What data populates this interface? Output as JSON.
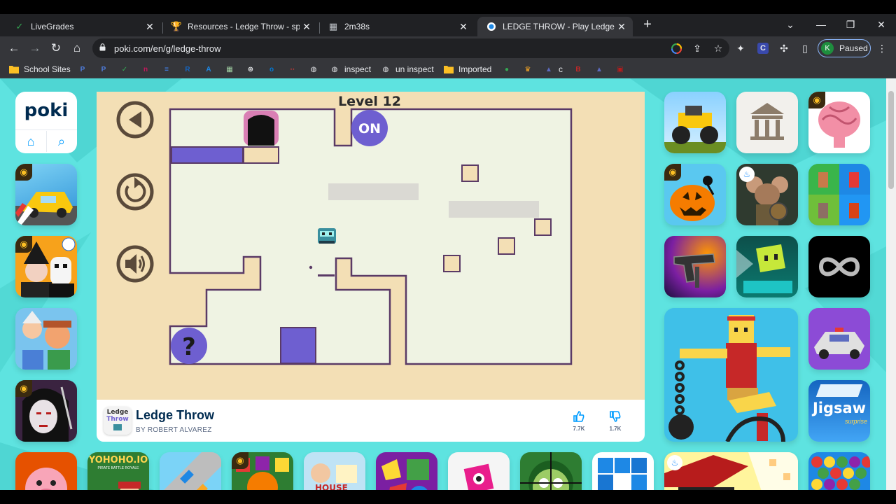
{
  "browser": {
    "tabs": [
      {
        "title": "LiveGrades",
        "icon": "check-icon",
        "active": false
      },
      {
        "title": "Resources - Ledge Throw - speed",
        "icon": "trophy-icon",
        "active": false
      },
      {
        "title": "2m38s",
        "icon": "image-icon",
        "active": false
      },
      {
        "title": "LEDGE THROW - Play Ledge Thro",
        "icon": "poki-icon",
        "active": true
      }
    ],
    "url": "poki.com/en/g/ledge-throw",
    "profile_initial": "K",
    "profile_status": "Paused"
  },
  "bookmarks": [
    {
      "label": "School Sites",
      "icon": "folder-icon",
      "color": "#fbbf24"
    },
    {
      "label": "",
      "icon": "p-icon",
      "color": "#4f7ddc",
      "text": "P"
    },
    {
      "label": "",
      "icon": "p-icon",
      "color": "#4f7ddc",
      "text": "P"
    },
    {
      "label": "",
      "icon": "check-icon",
      "color": "#34a853",
      "text": "✓"
    },
    {
      "label": "",
      "icon": "n-icon",
      "color": "#c2185b",
      "text": "n"
    },
    {
      "label": "",
      "icon": "doc-icon",
      "color": "#4285f4",
      "text": "≡"
    },
    {
      "label": "",
      "icon": "r-icon",
      "color": "#1565c0",
      "text": "R"
    },
    {
      "label": "",
      "icon": "a-icon",
      "color": "#1e88e5",
      "text": "A"
    },
    {
      "label": "",
      "icon": "sheet-icon",
      "color": "#a5d6a7",
      "text": "▦"
    },
    {
      "label": "",
      "icon": "chrome-icon",
      "color": "#e8eaed",
      "text": "⊛"
    },
    {
      "label": "",
      "icon": "outlook-icon",
      "color": "#0078d4",
      "text": "o"
    },
    {
      "label": "",
      "icon": "dots-icon",
      "color": "#e53935",
      "text": "··"
    },
    {
      "label": "",
      "icon": "globe-icon",
      "color": "#e8eaed",
      "text": "◍"
    },
    {
      "label": "inspect",
      "icon": "globe-icon",
      "color": "#e8eaed",
      "text": "◍"
    },
    {
      "label": "un inspect",
      "icon": "globe-icon",
      "color": "#e8eaed",
      "text": "◍"
    },
    {
      "label": "Imported",
      "icon": "folder-icon",
      "color": "#fbbf24"
    },
    {
      "label": "",
      "icon": "circle-icon",
      "color": "#34a853",
      "text": "●"
    },
    {
      "label": "",
      "icon": "crown-icon",
      "color": "#f9a825",
      "text": "♛"
    },
    {
      "label": "c",
      "icon": "bird-icon",
      "color": "#5c6bc0",
      "text": "▲"
    },
    {
      "label": "",
      "icon": "b-icon",
      "color": "#c62828",
      "text": "B"
    },
    {
      "label": "",
      "icon": "bird-icon",
      "color": "#5c6bc0",
      "text": "▲"
    },
    {
      "label": "",
      "icon": "fbi-icon",
      "color": "#b71c1c",
      "text": "▣"
    }
  ],
  "poki": {
    "logo_text": "poki",
    "home_label": "⌂",
    "search_label": "⌕"
  },
  "game": {
    "level_text": "Level 12",
    "switch_text": "ON",
    "help_text": "?",
    "title": "Ledge Throw",
    "author": "BY ROBERT ALVAREZ",
    "likes": "7.7K",
    "dislikes": "1.7K",
    "icon_line1": "Ledge",
    "icon_line2": "Throw"
  },
  "tiles_text": {
    "yohoho": "YOHOHO.IO",
    "yohoho_sub": "PIRATE BATTLE ROYALE",
    "jigsaw": "Jigsaw",
    "jigsaw_sub": "surprise",
    "house": "HOUSE"
  },
  "colors": {
    "page_bg": "#5ee3e0",
    "accent": "#6e5fd0",
    "level_outline": "#5a3a66"
  }
}
